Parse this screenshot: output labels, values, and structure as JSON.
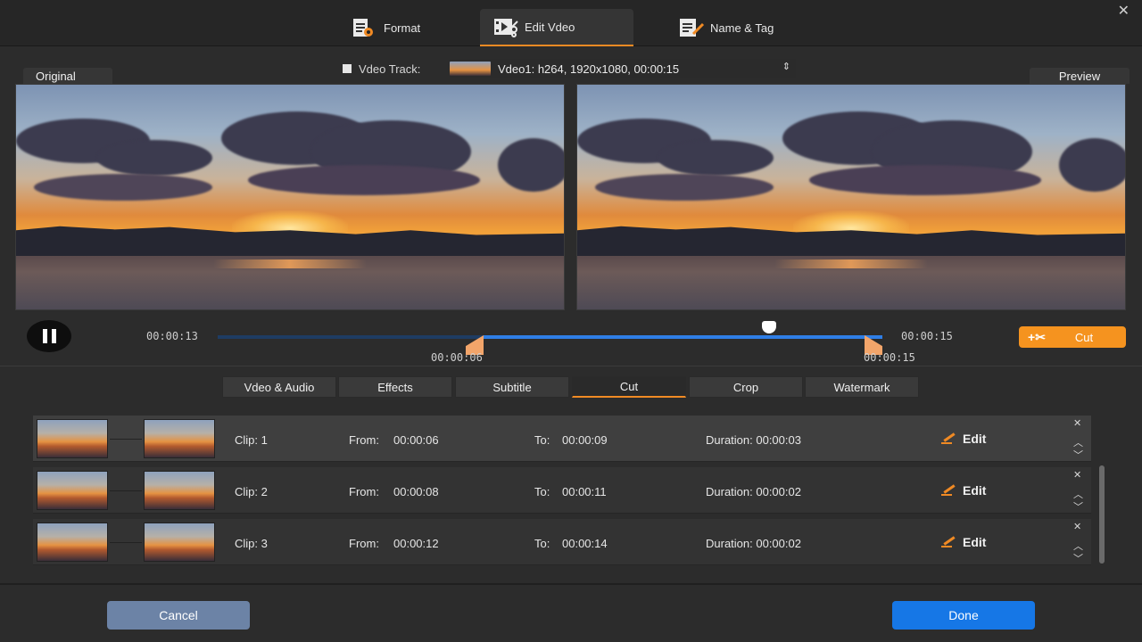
{
  "header": {
    "tabs": [
      {
        "label": "Format",
        "icon": "format-icon",
        "active": false
      },
      {
        "label": "Edit Vdeo",
        "icon": "edit-video-icon",
        "active": true
      },
      {
        "label": "Name & Tag",
        "icon": "name-tag-icon",
        "active": false
      }
    ],
    "close_icon": "close-icon"
  },
  "track": {
    "label": "Vdeo Track:",
    "value": "Vdeo1: h264, 1920x1080, 00:00:15"
  },
  "panels": {
    "original_label": "Original",
    "preview_label": "Preview"
  },
  "playback": {
    "current_time": "00:00:13",
    "end_time": "00:00:15",
    "handle_start_time": "00:00:06",
    "handle_end_time": "00:00:15",
    "cut_label": "Cut",
    "selection_start_fraction": 0.4,
    "selection_end_fraction": 1.0,
    "playhead_fraction": 0.83
  },
  "subtabs": [
    {
      "label": "Vdeo & Audio",
      "active": false
    },
    {
      "label": "Effects",
      "active": false
    },
    {
      "label": "Subtitle",
      "active": false
    },
    {
      "label": "Cut",
      "active": true
    },
    {
      "label": "Crop",
      "active": false
    },
    {
      "label": "Watermark",
      "active": false
    }
  ],
  "clips": [
    {
      "clip": "Clip: 1",
      "from_label": "From:",
      "from": "00:00:06",
      "to_label": "To:",
      "to": "00:00:09",
      "duration": "Duration: 00:00:03",
      "edit": "Edit",
      "selected": true
    },
    {
      "clip": "Clip: 2",
      "from_label": "From:",
      "from": "00:00:08",
      "to_label": "To:",
      "to": "00:00:11",
      "duration": "Duration: 00:00:02",
      "edit": "Edit",
      "selected": false
    },
    {
      "clip": "Clip: 3",
      "from_label": "From:",
      "from": "00:00:12",
      "to_label": "To:",
      "to": "00:00:14",
      "duration": "Duration: 00:00:02",
      "edit": "Edit",
      "selected": false
    }
  ],
  "footer": {
    "cancel_label": "Cancel",
    "done_label": "Done"
  },
  "colors": {
    "accent": "#f08a24",
    "primary": "#1677e6",
    "cancel": "#6c83a6"
  }
}
